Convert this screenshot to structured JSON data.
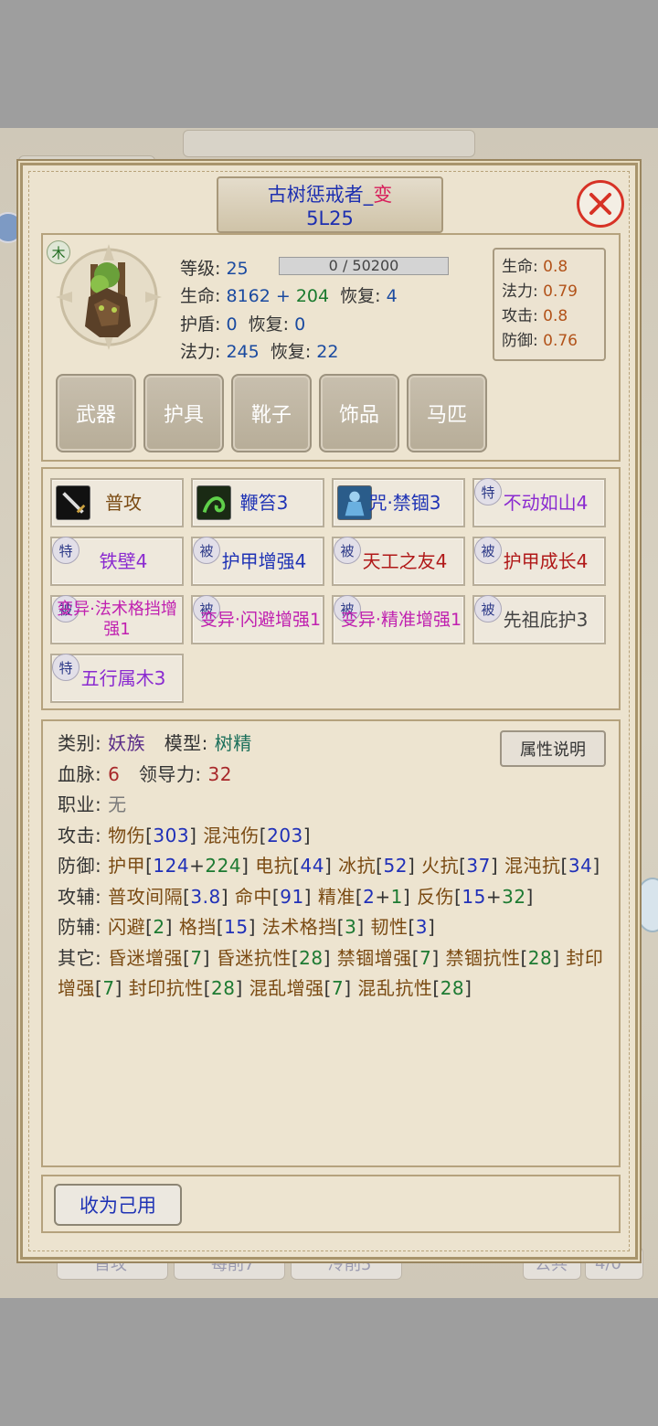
{
  "background": {
    "tabs": [
      "首攻",
      "每削7",
      "冷削5"
    ],
    "right_buttons": [
      "公共",
      "4/0"
    ]
  },
  "pet": {
    "name": "古树惩戒者_",
    "name_suffix": "变",
    "level_code": "5L25",
    "element": "木",
    "stats": {
      "level_label": "等级:",
      "level": "25",
      "exp": "0 / 50200",
      "hp_label": "生命:",
      "hp_base": "8162",
      "hp_plus": " + ",
      "hp_bonus": "204",
      "hp_regen_label": "恢复:",
      "hp_regen": "4",
      "shield_label": "护盾:",
      "shield": "0",
      "shield_regen_label": "恢复:",
      "shield_regen": "0",
      "mp_label": "法力:",
      "mp": "245",
      "mp_regen_label": "恢复:",
      "mp_regen": "22"
    },
    "ratios": [
      {
        "label": "生命:",
        "value": "0.8"
      },
      {
        "label": "法力:",
        "value": "0.79"
      },
      {
        "label": "攻击:",
        "value": "0.8"
      },
      {
        "label": "防御:",
        "value": "0.76"
      }
    ]
  },
  "equipment": [
    "武器",
    "护具",
    "靴子",
    "饰品",
    "马匹"
  ],
  "skills": [
    {
      "label": "普攻",
      "tag": "",
      "icon": "sword-icon",
      "color": "brown"
    },
    {
      "label": "鞭笞3",
      "tag": "",
      "icon": "vine-whip-icon",
      "color": "blue"
    },
    {
      "label": "咒·禁锢3",
      "tag": "",
      "icon": "imprison-icon",
      "color": "blue"
    },
    {
      "label": "不动如山4",
      "tag": "特",
      "icon": "",
      "color": "purple"
    },
    {
      "label": "铁壁4",
      "tag": "特",
      "icon": "",
      "color": "purple"
    },
    {
      "label": "护甲增强4",
      "tag": "被",
      "icon": "",
      "color": "blue"
    },
    {
      "label": "天工之友4",
      "tag": "被",
      "icon": "",
      "color": "red"
    },
    {
      "label": "护甲成长4",
      "tag": "被",
      "icon": "",
      "color": "red"
    },
    {
      "label": "变异·法术格挡增强1",
      "tag": "被",
      "icon": "",
      "color": "magenta"
    },
    {
      "label": "变异·闪避增强1",
      "tag": "被",
      "icon": "",
      "color": "magenta"
    },
    {
      "label": "变异·精准增强1",
      "tag": "被",
      "icon": "",
      "color": "magenta"
    },
    {
      "label": "先祖庇护3",
      "tag": "被",
      "icon": "",
      "color": "gray"
    },
    {
      "label": "五行属木3",
      "tag": "特",
      "icon": "",
      "color": "purple"
    }
  ],
  "attributes": {
    "category_label": "类别:",
    "category": "妖族",
    "model_label": "模型:",
    "model": "树精",
    "bloodline_label": "血脉:",
    "bloodline": "6",
    "leadership_label": "领导力:",
    "leadership": "32",
    "job_label": "职业:",
    "job": "无",
    "attack_label": "攻击:",
    "defense_label": "防御:",
    "assist_atk_label": "攻辅:",
    "assist_def_label": "防辅:",
    "other_label": "其它:",
    "explain_button": "属性说明"
  },
  "actions": {
    "claim_button": "收为己用"
  }
}
